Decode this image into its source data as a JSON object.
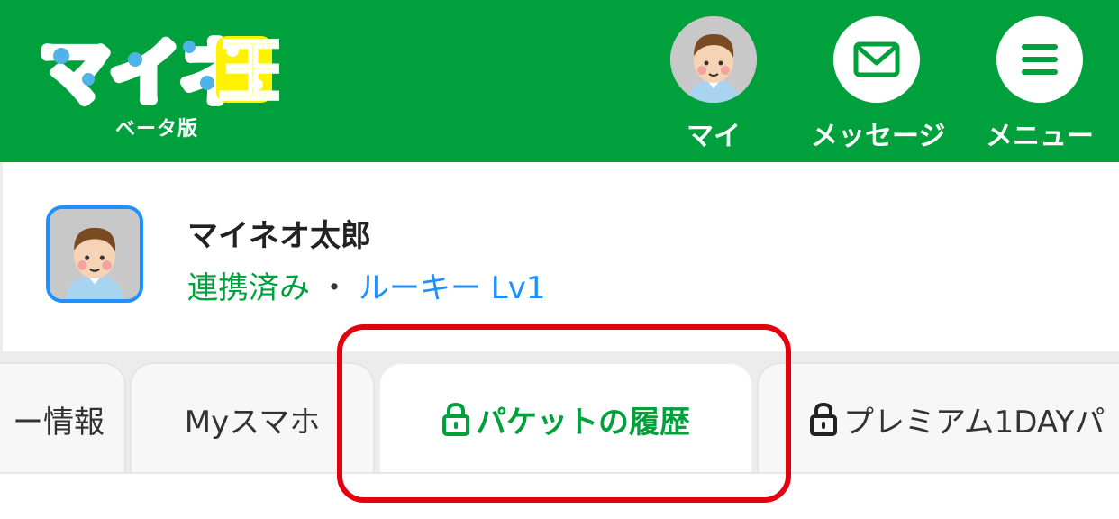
{
  "header": {
    "logo_text": "マイネ王",
    "logo_sub": "ベータ版",
    "nav": [
      {
        "label": "マイ",
        "icon": "user-avatar-icon"
      },
      {
        "label": "メッセージ",
        "icon": "envelope-icon"
      },
      {
        "label": "メニュー",
        "icon": "hamburger-menu-icon"
      }
    ]
  },
  "profile": {
    "name": "マイネオ太郎",
    "status_linked": "連携済み",
    "separator": "・",
    "rank": "ルーキー Lv1"
  },
  "tabs": [
    {
      "label": "ー情報",
      "locked": false,
      "active": false
    },
    {
      "label": "Myスマホ",
      "locked": false,
      "active": false
    },
    {
      "label": "パケットの履歴",
      "locked": true,
      "active": true
    },
    {
      "label": "プレミアム1DAYパ",
      "locked": true,
      "active": false
    }
  ],
  "colors": {
    "brand_green": "#00a03c",
    "link_blue": "#1e90ff",
    "highlight_red": "#e3000f"
  }
}
